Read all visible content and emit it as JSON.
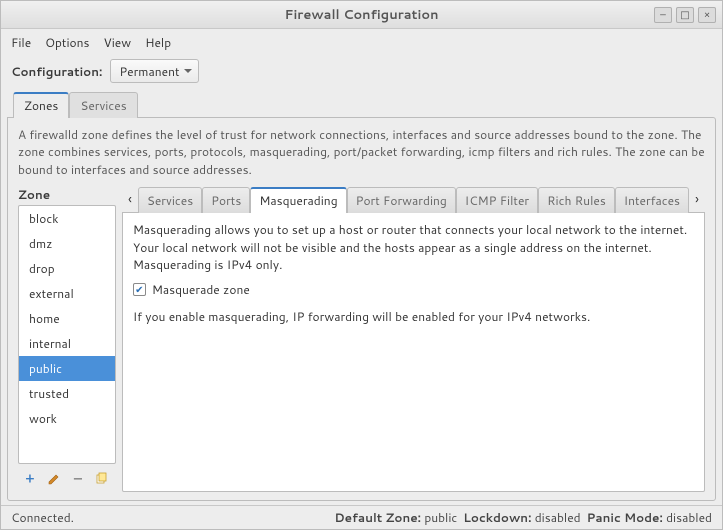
{
  "window": {
    "title": "Firewall Configuration"
  },
  "menubar": {
    "file": "File",
    "options": "Options",
    "view": "View",
    "help": "Help"
  },
  "config": {
    "label": "Configuration:",
    "selected": "Permanent"
  },
  "notebook": {
    "tabs": {
      "zones": "Zones",
      "services": "Services"
    },
    "active": "zones",
    "zone_desc": "A firewalld zone defines the level of trust for network connections, interfaces and source addresses bound to the zone. The zone combines services, ports, protocols, masquerading, port/packet forwarding, icmp filters and rich rules. The zone can be bound to interfaces and source addresses."
  },
  "zone_panel": {
    "label": "Zone",
    "items": [
      "block",
      "dmz",
      "drop",
      "external",
      "home",
      "internal",
      "public",
      "trusted",
      "work"
    ],
    "selected": "public"
  },
  "subtabs": {
    "items": [
      "Services",
      "Ports",
      "Masquerading",
      "Port Forwarding",
      "ICMP Filter",
      "Rich Rules",
      "Interfaces"
    ],
    "active": "Masquerading"
  },
  "masq": {
    "desc": "Masquerading allows you to set up a host or router that connects your local network to the internet. Your local network will not be visible and the hosts appear as a single address on the internet. Masquerading is IPv4 only.",
    "checkbox_label": "Masquerade zone",
    "checked": true,
    "note": "If you enable masquerading, IP forwarding will be enabled for your IPv4 networks."
  },
  "status": {
    "left": "Connected.",
    "default_zone_label": "Default Zone:",
    "default_zone": "public",
    "lockdown_label": "Lockdown:",
    "lockdown": "disabled",
    "panic_label": "Panic Mode:",
    "panic": "disabled"
  }
}
